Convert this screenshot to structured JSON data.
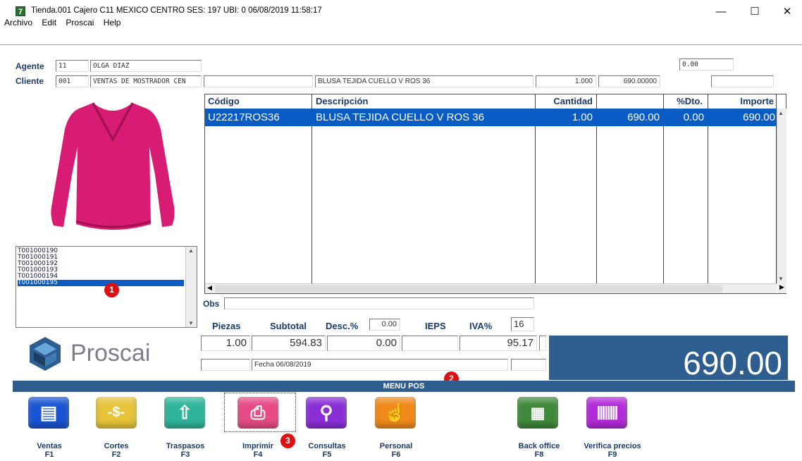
{
  "window": {
    "title": "Tienda.001  Cajero C11  MEXICO CENTRO   SES: 197  UBI: 0  06/08/2019 11:58:17",
    "icon": "app-icon"
  },
  "menu": [
    "Archivo",
    "Edit",
    "Proscai",
    "Help"
  ],
  "header": {
    "agente_label": "Agente",
    "agente_code": "11",
    "agente_name": "OLGA DIAZ",
    "top_right_value": "0.00",
    "cliente_label": "Cliente",
    "cliente_code": "001",
    "cliente_name": "VENTAS DE MOSTRADOR CEN",
    "extra_field": "",
    "item_desc": "BLUSA TEJIDA CUELLO V ROS 36",
    "item_qty": "1.000",
    "item_price": "690.00000",
    "item_extra": ""
  },
  "grid": {
    "columns": [
      "Código",
      "Descripción",
      "Cantidad",
      "",
      "%Dto.",
      "Importe"
    ],
    "rows": [
      {
        "codigo": "U22217ROS36",
        "descripcion": "BLUSA TEJIDA CUELLO V ROS 36",
        "cantidad": "1.00",
        "precio": "690.00",
        "dto": "0.00",
        "importe": "690.00"
      }
    ]
  },
  "tickets": [
    "T001000190",
    "T001000191",
    "T001000192",
    "T001000193",
    "T001000194",
    "T001000195"
  ],
  "selected_ticket": "T001000195",
  "badges": [
    "1",
    "2",
    "3"
  ],
  "obs": {
    "label": "Obs",
    "value": ""
  },
  "totals": {
    "piezas_label": "Piezas",
    "subtotal_label": "Subtotal",
    "desc_label": "Desc.%",
    "desc_value": "0.00",
    "ieps_label": "IEPS",
    "iva_label": "IVA%",
    "iva_value": "16",
    "piezas": "1.00",
    "subtotal": "594.83",
    "descuento": "0.00",
    "ieps": "",
    "iva": "95.17",
    "fecha": "Fecha 06/08/2019",
    "total": "690.00"
  },
  "brand": {
    "name": "Proscai",
    "color": "#2e5d8f"
  },
  "menu_pos": {
    "title": "MENU POS",
    "buttons": [
      {
        "label": "Ventas",
        "key": "F1",
        "icon": "pos-terminal-icon",
        "color": "#1a54d4"
      },
      {
        "label": "Cortes",
        "key": "F2",
        "icon": "cash-icon",
        "color": "#e8c43a"
      },
      {
        "label": "Traspasos",
        "key": "F3",
        "icon": "transfer-icon",
        "color": "#2fb59a"
      },
      {
        "label": "Imprimir",
        "key": "F4",
        "icon": "printer-icon",
        "color": "#e84b86"
      },
      {
        "label": "Consultas",
        "key": "F5",
        "icon": "search-icon",
        "color": "#8a2fd6"
      },
      {
        "label": "Personal",
        "key": "F6",
        "icon": "hand-pointer-icon",
        "color": "#f08a1a"
      },
      {
        "label": "Back office",
        "key": "F8",
        "icon": "building-icon",
        "color": "#3f8a3a"
      },
      {
        "label": "Verifica precios",
        "key": "F9",
        "icon": "barcode-icon",
        "color": "#b32ad9"
      }
    ]
  }
}
